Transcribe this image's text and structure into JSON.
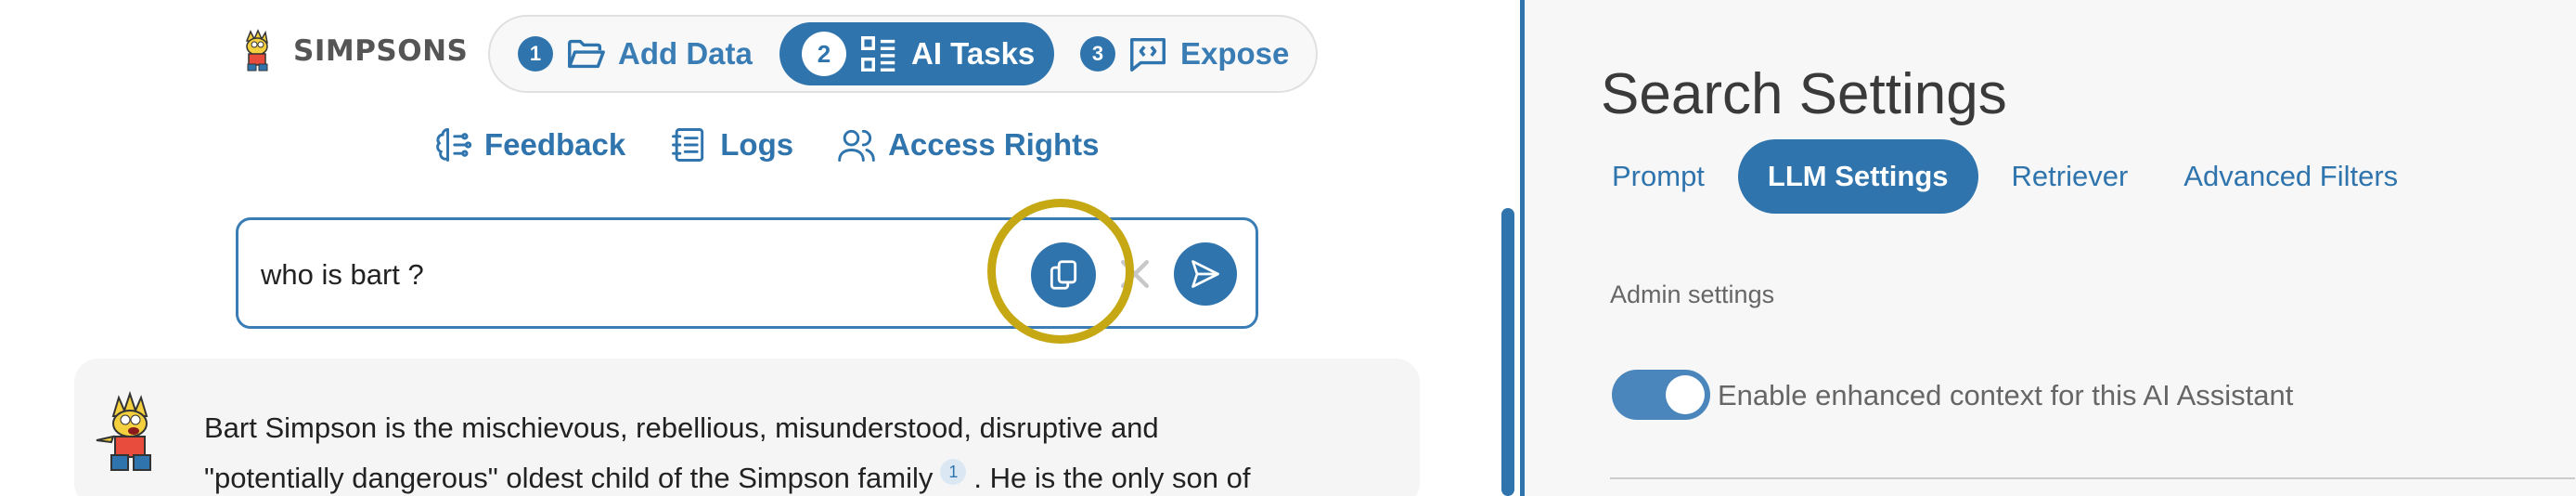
{
  "brand": {
    "name": "SIMPSONS"
  },
  "stepper": [
    {
      "num": "1",
      "label": "Add Data",
      "icon": "folder-open-icon"
    },
    {
      "num": "2",
      "label": "AI Tasks",
      "icon": "tasks-list-icon"
    },
    {
      "num": "3",
      "label": "Expose",
      "icon": "code-chat-icon"
    }
  ],
  "links": [
    {
      "label": "Feedback",
      "icon": "brain-icon"
    },
    {
      "label": "Logs",
      "icon": "notebook-icon"
    },
    {
      "label": "Access Rights",
      "icon": "users-icon"
    }
  ],
  "search": {
    "value": "who is bart ?"
  },
  "answer": {
    "line1": "Bart Simpson is the mischievous, rebellious, misunderstood, disruptive and",
    "line2a": "\"potentially dangerous\" oldest child of the Simpson family",
    "cite": "1",
    "line2b": ". He is the only son of"
  },
  "settings": {
    "title": "Search Settings",
    "tabs": [
      "Prompt",
      "LLM Settings",
      "Retriever",
      "Advanced Filters"
    ],
    "section_label": "Admin settings",
    "toggle_label": "Enable enhanced context for this AI Assistant",
    "toggle_on": true
  },
  "colors": {
    "accent": "#2f74ad",
    "highlight": "#c6a815",
    "panel": "#f7f7f7"
  }
}
